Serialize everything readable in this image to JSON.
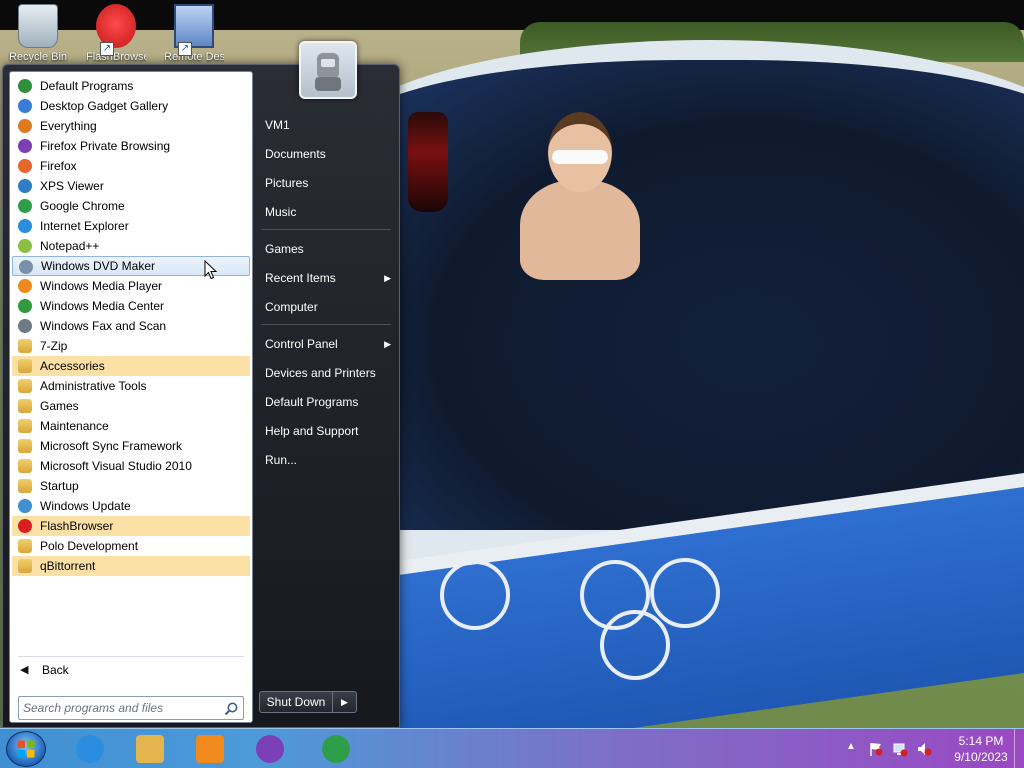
{
  "desktop": {
    "icons": [
      {
        "name": "Recycle Bin",
        "label": "Recycle Bin"
      },
      {
        "name": "FlashBrowser",
        "label": "FlashBrowser"
      },
      {
        "name": "Remote Desktop",
        "label": "Remote Desktop Connection"
      }
    ]
  },
  "start_menu": {
    "programs": [
      {
        "label": "Default Programs",
        "icon": "default-programs-icon",
        "color": "#2f8f3a",
        "state": "normal"
      },
      {
        "label": "Desktop Gadget Gallery",
        "icon": "gadget-gallery-icon",
        "color": "#3a7bd5",
        "state": "normal"
      },
      {
        "label": "Everything",
        "icon": "everything-search-icon",
        "color": "#e07a1e",
        "state": "normal"
      },
      {
        "label": "Firefox Private Browsing",
        "icon": "firefox-private-icon",
        "color": "#7b3fb8",
        "state": "normal"
      },
      {
        "label": "Firefox",
        "icon": "firefox-icon",
        "color": "#e8662a",
        "state": "normal"
      },
      {
        "label": "XPS Viewer",
        "icon": "xps-viewer-icon",
        "color": "#2d7ec6",
        "state": "normal"
      },
      {
        "label": "Google Chrome",
        "icon": "chrome-icon",
        "color": "#2e9e4b",
        "state": "normal"
      },
      {
        "label": "Internet Explorer",
        "icon": "internet-explorer-icon",
        "color": "#2b8de0",
        "state": "normal"
      },
      {
        "label": "Notepad++",
        "icon": "notepad-plus-plus-icon",
        "color": "#8bbf44",
        "state": "normal"
      },
      {
        "label": "Windows DVD Maker",
        "icon": "dvd-maker-icon",
        "color": "#7a8fa8",
        "state": "hover"
      },
      {
        "label": "Windows Media Player",
        "icon": "media-player-icon",
        "color": "#f08a1c",
        "state": "normal"
      },
      {
        "label": "Windows Media Center",
        "icon": "media-center-icon",
        "color": "#2e9b3f",
        "state": "normal"
      },
      {
        "label": "Windows Fax and Scan",
        "icon": "fax-scan-icon",
        "color": "#6f7a86",
        "state": "normal"
      },
      {
        "label": "7-Zip",
        "icon": "folder-icon",
        "color": "#e4b44e",
        "state": "normal"
      },
      {
        "label": "Accessories",
        "icon": "folder-icon",
        "color": "#e4b44e",
        "state": "highlight"
      },
      {
        "label": "Administrative Tools",
        "icon": "folder-icon",
        "color": "#e4b44e",
        "state": "normal"
      },
      {
        "label": "Games",
        "icon": "folder-icon",
        "color": "#e4b44e",
        "state": "normal"
      },
      {
        "label": "Maintenance",
        "icon": "folder-icon",
        "color": "#e4b44e",
        "state": "normal"
      },
      {
        "label": "Microsoft Sync Framework",
        "icon": "folder-icon",
        "color": "#e4b44e",
        "state": "normal"
      },
      {
        "label": "Microsoft Visual Studio 2010",
        "icon": "folder-icon",
        "color": "#e4b44e",
        "state": "normal"
      },
      {
        "label": "Startup",
        "icon": "folder-icon",
        "color": "#e4b44e",
        "state": "normal"
      },
      {
        "label": "Windows Update",
        "icon": "windows-update-icon",
        "color": "#3f8fd2",
        "state": "normal"
      },
      {
        "label": "FlashBrowser",
        "icon": "flashbrowser-icon",
        "color": "#d92020",
        "state": "highlight"
      },
      {
        "label": "Polo Development",
        "icon": "folder-icon",
        "color": "#e4b44e",
        "state": "normal"
      },
      {
        "label": "qBittorrent",
        "icon": "folder-icon",
        "color": "#e4b44e",
        "state": "highlight"
      }
    ],
    "back_label": "Back",
    "search_placeholder": "Search programs and files",
    "right_items": [
      {
        "label": "VM1",
        "has_submenu": false
      },
      {
        "label": "Documents",
        "has_submenu": false
      },
      {
        "label": "Pictures",
        "has_submenu": false
      },
      {
        "label": "Music",
        "has_submenu": false
      },
      {
        "label": "Games",
        "has_submenu": false
      },
      {
        "label": "Recent Items",
        "has_submenu": true
      },
      {
        "label": "Computer",
        "has_submenu": false
      },
      {
        "label": "Control Panel",
        "has_submenu": true
      },
      {
        "label": "Devices and Printers",
        "has_submenu": false
      },
      {
        "label": "Default Programs",
        "has_submenu": false
      },
      {
        "label": "Help and Support",
        "has_submenu": false
      },
      {
        "label": "Run...",
        "has_submenu": false
      }
    ],
    "shutdown_label": "Shut Down",
    "shutdown_arrow": "▶"
  },
  "taskbar": {
    "pinned": [
      {
        "name": "internet-explorer",
        "color": "#2b8de0"
      },
      {
        "name": "file-explorer",
        "color": "#e4b44e"
      },
      {
        "name": "media-player",
        "color": "#f08a1c"
      },
      {
        "name": "firefox-private",
        "color": "#7b3fb8"
      },
      {
        "name": "chrome",
        "color": "#2e9e4b"
      }
    ],
    "tray": {
      "time": "5:14 PM",
      "date": "9/10/2023"
    }
  },
  "colors": {
    "hover_row": "#d7e6f7",
    "highlight_row": "#fbe1a6"
  }
}
